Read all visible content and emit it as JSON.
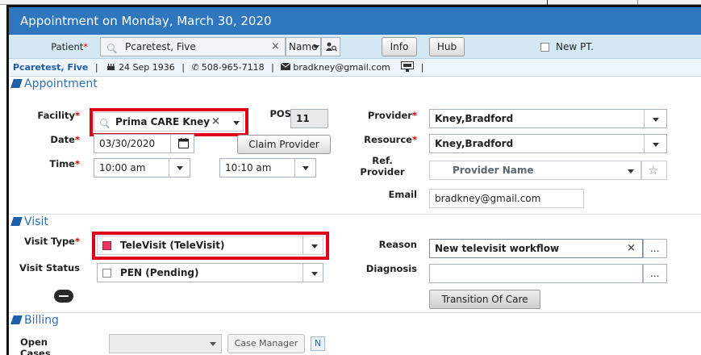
{
  "title": "Appointment on Monday, March 30, 2020",
  "patient_bar": {
    "patient_label": "Patient",
    "required_mark": "*",
    "patient_value": "Pcaretest, Five",
    "search_mode": "Name",
    "info_button": "Info",
    "hub_button": "Hub",
    "new_pt_label": "New PT."
  },
  "patient_info": {
    "name": "Pcaretest, Five",
    "dob": "24 Sep 1936",
    "phone": "508-965-7118",
    "email": "bradkney@gmail.com",
    "sep": "|"
  },
  "appointment": {
    "section_title": "Appointment",
    "facility_label": "Facility",
    "facility_value": "Prima CARE Kney",
    "pos_label": "POS",
    "pos_value": "11",
    "date_label": "Date",
    "date_value": "03/30/2020",
    "claim_provider_button": "Claim Provider",
    "time_label": "Time",
    "start_time": "10:00 am",
    "end_time": "10:10 am",
    "provider_label": "Provider",
    "provider_value": "Kney,Bradford",
    "resource_label": "Resource",
    "resource_value": "Kney,Bradford",
    "ref_provider_label_1": "Ref.",
    "ref_provider_label_2": "Provider",
    "ref_provider_placeholder": "Provider Name",
    "email_label": "Email",
    "email_value": "bradkney@gmail.com"
  },
  "visit": {
    "section_title": "Visit",
    "visit_type_label": "Visit Type",
    "visit_type_value": "TeleVisit (TeleVisit)",
    "visit_status_label": "Visit Status",
    "visit_status_value": "PEN (Pending)",
    "reason_label": "Reason",
    "reason_value": "New televisit workflow",
    "diagnosis_label": "Diagnosis",
    "diagnosis_value": "",
    "ellipsis": "...",
    "transition_button": "Transition Of Care"
  },
  "billing": {
    "section_title": "Billing",
    "open_cases_label": "Open Cases",
    "case_manager_button": "Case Manager",
    "n_button": "N"
  },
  "colors": {
    "title_bar": "#2e77bf",
    "highlight": "#e0001b",
    "section_title": "#2e6fb8"
  }
}
